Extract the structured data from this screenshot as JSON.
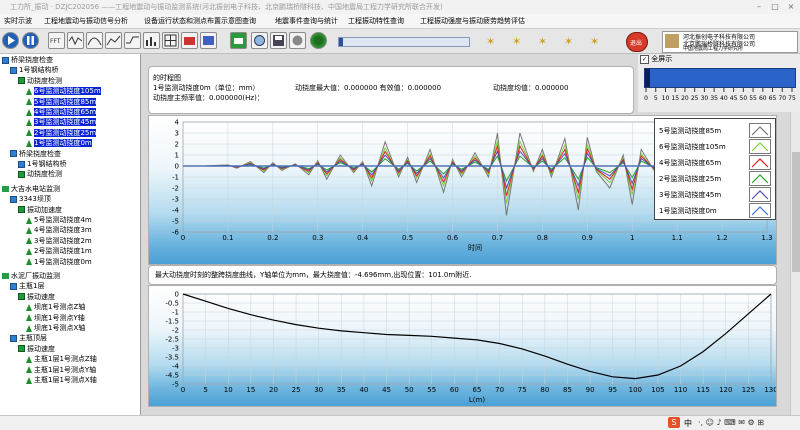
{
  "window_title": "工力所_振动 · DZJC202056 ——工程地震动与振动监测系统(河北振创电子科技、北京鹏瑞桥隧科技、中国地震局工程力学研究所联合开发)",
  "menu": [
    "实时示波",
    "工程地震动与振动信号分析",
    "设备运行状态和测点布置示意图查询",
    "地震事件查询与统计",
    "工程振动特性查询",
    "工程振动强度与振动疲劳趋势评估"
  ],
  "company_logo": {
    "line1": "河北振创电子科技有限公司",
    "line2": "北京鹏瑞桥隧科技有限公司",
    "line3": "中国地震局工程力学研究所"
  },
  "stop_label": "退出",
  "zoom_checkbox_label": "全屏示",
  "sidebar": {
    "items": [
      {
        "label": "桥梁挠度检查",
        "indent": 0,
        "icon": "net"
      },
      {
        "label": "1号钢结构桥",
        "indent": 1,
        "icon": "net"
      },
      {
        "label": "动挠度检测",
        "indent": 2,
        "icon": "sq"
      },
      {
        "label": "6号监测动挠度105m",
        "indent": 3,
        "icon": "tri",
        "selected": true
      },
      {
        "label": "5号监测动挠度85m",
        "indent": 3,
        "icon": "tri",
        "selected": true
      },
      {
        "label": "4号监测动挠度65m",
        "indent": 3,
        "icon": "tri",
        "selected": true
      },
      {
        "label": "3号监测动挠度45m",
        "indent": 3,
        "icon": "tri",
        "selected": true
      },
      {
        "label": "2号监测动挠度25m",
        "indent": 3,
        "icon": "tri",
        "selected": true
      },
      {
        "label": "1号监测动挠度0m",
        "indent": 3,
        "icon": "tri",
        "selected": true
      },
      {
        "label": "桥梁挠度检查",
        "indent": 1,
        "icon": "net"
      },
      {
        "label": "1号钢结构桥",
        "indent": 2,
        "icon": "net"
      },
      {
        "label": "动挠度检测",
        "indent": 2,
        "icon": "sq"
      },
      {
        "label": "",
        "indent": 0,
        "icon": "none"
      },
      {
        "label": "大吉水电站监测",
        "indent": 0,
        "icon": "flag"
      },
      {
        "label": "3343坝顶",
        "indent": 1,
        "icon": "net"
      },
      {
        "label": "振动加速度",
        "indent": 2,
        "icon": "sq"
      },
      {
        "label": "5号监测动挠度4m",
        "indent": 3,
        "icon": "tri"
      },
      {
        "label": "4号监测动挠度3m",
        "indent": 3,
        "icon": "tri"
      },
      {
        "label": "3号监测动挠度2m",
        "indent": 3,
        "icon": "tri"
      },
      {
        "label": "2号监测动挠度1m",
        "indent": 3,
        "icon": "tri"
      },
      {
        "label": "1号监测动挠度0m",
        "indent": 3,
        "icon": "tri"
      },
      {
        "label": "",
        "indent": 0,
        "icon": "none"
      },
      {
        "label": "水泥厂振动监测",
        "indent": 0,
        "icon": "flag"
      },
      {
        "label": "主瓶1层",
        "indent": 1,
        "icon": "net"
      },
      {
        "label": "振动速度",
        "indent": 2,
        "icon": "sq"
      },
      {
        "label": "坝底1号测点Z轴",
        "indent": 3,
        "icon": "tri"
      },
      {
        "label": "坝底1号测点Y轴",
        "indent": 3,
        "icon": "tri"
      },
      {
        "label": "坝底1号测点X轴",
        "indent": 3,
        "icon": "tri"
      },
      {
        "label": "主瓶顶层",
        "indent": 1,
        "icon": "net"
      },
      {
        "label": "振动速度",
        "indent": 2,
        "icon": "sq"
      },
      {
        "label": "主瓶1层1号测点Z轴",
        "indent": 3,
        "icon": "tri"
      },
      {
        "label": "主瓶1层1号测点Y轴",
        "indent": 3,
        "icon": "tri"
      },
      {
        "label": "主瓶1层1号测点X轴",
        "indent": 3,
        "icon": "tri"
      }
    ]
  },
  "info": {
    "heading": "的时程图",
    "line1a": "1号监测动挠度0m（单位：mm）",
    "line1b": "动挠度最大值：0.000000 有效值：0.000000",
    "line1c": "动挠度均值：0.000000",
    "line2": "动挠度主频率值：0.000000(Hz)："
  },
  "slider": {
    "ticks": [
      "0",
      "5",
      "10",
      "15",
      "20",
      "25",
      "30",
      "35",
      "40",
      "45",
      "50",
      "55",
      "60",
      "65",
      "70",
      "75"
    ],
    "value": 0
  },
  "colors": {
    "series_85m": "#777777",
    "series_105m": "#7fcf3a",
    "series_65m": "#e02020",
    "series_25m": "#2aa02a",
    "series_45m": "#5050b0",
    "series_0m": "#4070d0",
    "selection": "#0a24d6"
  },
  "chart_data": [
    {
      "type": "line",
      "xlabel": "时间",
      "ylabel": "",
      "xlim": [
        0,
        1.3
      ],
      "ylim": [
        -6,
        4
      ],
      "xticks": [
        "0",
        "0.1",
        "0.2",
        "0.3",
        "0.4",
        "0.5",
        "0.6",
        "0.7",
        "0.8",
        "0.9",
        "1",
        "1.1",
        "1.2",
        "1.3"
      ],
      "yticks": [
        "4",
        "3",
        "2",
        "1",
        "0",
        "-1",
        "-2",
        "-3",
        "-4",
        "-5",
        "-6"
      ],
      "x": [
        0,
        0.05,
        0.1,
        0.12,
        0.15,
        0.18,
        0.2,
        0.22,
        0.25,
        0.28,
        0.3,
        0.32,
        0.35,
        0.38,
        0.4,
        0.42,
        0.45,
        0.48,
        0.5,
        0.52,
        0.55,
        0.58,
        0.6,
        0.62,
        0.65,
        0.68,
        0.7,
        0.72,
        0.75,
        0.78,
        0.8,
        0.82,
        0.85,
        0.88,
        0.9,
        0.92,
        0.95,
        0.98,
        1.0,
        1.02,
        1.05,
        1.08,
        1.1,
        1.12,
        1.15,
        1.18,
        1.2,
        1.22,
        1.25,
        1.28,
        1.3
      ],
      "series": [
        {
          "name": "5号监测动挠度85m",
          "color_key": "series_85m",
          "values": [
            0,
            0,
            0.1,
            -0.2,
            0.4,
            -0.6,
            0.3,
            -0.4,
            0.2,
            -0.8,
            0.5,
            -1.2,
            1.0,
            -0.6,
            0.4,
            -1.8,
            2.2,
            -1.0,
            0.8,
            -1.5,
            1.5,
            -2.4,
            0.6,
            -1.0,
            1.2,
            -1.0,
            3.0,
            -4.5,
            3.0,
            -0.5,
            1.5,
            -1.0,
            2.5,
            -4.0,
            2.6,
            -0.5,
            -2.0,
            1.0,
            -3.5,
            1.5,
            -0.5,
            1.0,
            2.0,
            -1.0,
            3.5,
            -1.5,
            1.0,
            -0.5,
            2.6,
            0.5,
            2.5
          ]
        },
        {
          "name": "6号监测动挠度105m",
          "color_key": "series_105m",
          "values": [
            0,
            0,
            0.08,
            -0.15,
            0.3,
            -0.45,
            0.22,
            -0.3,
            0.15,
            -0.6,
            0.38,
            -0.9,
            0.75,
            -0.45,
            0.3,
            -1.35,
            1.65,
            -0.75,
            0.6,
            -1.1,
            1.1,
            -1.8,
            0.45,
            -0.75,
            0.9,
            -0.75,
            2.25,
            -3.4,
            2.25,
            -0.38,
            1.1,
            -0.75,
            1.9,
            -3.0,
            1.95,
            -0.38,
            -1.5,
            0.75,
            -2.6,
            1.1,
            -0.38,
            0.75,
            1.5,
            -0.75,
            2.6,
            -1.1,
            0.75,
            -0.38,
            1.95,
            0.38,
            1.9
          ]
        },
        {
          "name": "4号监测动挠度65m",
          "color_key": "series_65m",
          "values": [
            0,
            0,
            0.06,
            -0.12,
            0.24,
            -0.36,
            0.18,
            -0.24,
            0.12,
            -0.48,
            0.3,
            -0.72,
            0.6,
            -0.36,
            0.24,
            -1.08,
            1.32,
            -0.6,
            0.48,
            -0.9,
            0.9,
            -1.44,
            0.36,
            -0.6,
            0.72,
            -0.6,
            1.8,
            -2.7,
            1.8,
            -0.3,
            0.9,
            -0.6,
            1.5,
            -2.4,
            1.56,
            -0.3,
            -1.2,
            0.6,
            -2.1,
            0.9,
            -0.3,
            0.6,
            1.2,
            -0.6,
            2.1,
            -0.9,
            0.6,
            -0.3,
            1.56,
            0.3,
            1.5
          ]
        },
        {
          "name": "2号监测动挠度25m",
          "color_key": "series_25m",
          "values": [
            0,
            0,
            0.03,
            -0.06,
            0.12,
            -0.18,
            0.09,
            -0.12,
            0.06,
            -0.24,
            0.15,
            -0.36,
            0.3,
            -0.18,
            0.12,
            -0.54,
            0.66,
            -0.3,
            0.24,
            -0.45,
            0.45,
            -0.72,
            0.18,
            -0.3,
            0.36,
            -0.3,
            0.9,
            -1.35,
            0.9,
            -0.15,
            0.45,
            -0.3,
            0.75,
            -1.2,
            0.78,
            -0.15,
            -0.6,
            0.3,
            -1.05,
            0.45,
            -0.15,
            0.3,
            0.6,
            -0.3,
            1.05,
            -0.45,
            0.3,
            -0.15,
            0.78,
            0.15,
            0.75
          ]
        },
        {
          "name": "3号监测动挠度45m",
          "color_key": "series_45m",
          "values": [
            0,
            0,
            0.05,
            -0.09,
            0.18,
            -0.27,
            0.14,
            -0.18,
            0.09,
            -0.36,
            0.23,
            -0.54,
            0.45,
            -0.27,
            0.18,
            -0.81,
            0.99,
            -0.45,
            0.36,
            -0.68,
            0.68,
            -1.08,
            0.27,
            -0.45,
            0.54,
            -0.45,
            1.35,
            -2.0,
            1.35,
            -0.23,
            0.68,
            -0.45,
            1.13,
            -1.8,
            1.17,
            -0.23,
            -0.9,
            0.45,
            -1.58,
            0.68,
            -0.23,
            0.45,
            0.9,
            -0.45,
            1.58,
            -0.68,
            0.45,
            -0.23,
            1.17,
            0.23,
            1.13
          ]
        },
        {
          "name": "1号监测动挠度0m",
          "color_key": "series_0m",
          "values": [
            0,
            0,
            0,
            0,
            0,
            0,
            0,
            0,
            0,
            0,
            0,
            0,
            0,
            0,
            0,
            0,
            0,
            0,
            0,
            0,
            0,
            0,
            0,
            0,
            0,
            0,
            0,
            0,
            0,
            0,
            0,
            0,
            0,
            0,
            0,
            0,
            0,
            0,
            0,
            0,
            0,
            0,
            0,
            0,
            0,
            0,
            0,
            0,
            0,
            0,
            0
          ]
        }
      ],
      "legend_position": "top-right"
    },
    {
      "type": "line",
      "title": "最大动挠度时刻的整跨挠度曲线，Y轴单位为mm，最大挠度值：-4.696mm,出现位置：101.0m附近.",
      "xlabel": "L(m)",
      "ylabel": "",
      "xlim": [
        0,
        130
      ],
      "ylim": [
        -5,
        0
      ],
      "xticks": [
        "0",
        "5",
        "10",
        "15",
        "20",
        "25",
        "30",
        "35",
        "40",
        "45",
        "50",
        "55",
        "60",
        "65",
        "70",
        "75",
        "80",
        "85",
        "90",
        "95",
        "100",
        "105",
        "110",
        "115",
        "120",
        "125",
        "130"
      ],
      "yticks": [
        "0",
        "-0.5",
        "-1",
        "-1.5",
        "-2",
        "-2.5",
        "-3",
        "-3.5",
        "-4",
        "-4.5",
        "-5"
      ],
      "x": [
        0,
        5,
        10,
        15,
        20,
        25,
        30,
        35,
        40,
        45,
        50,
        55,
        60,
        65,
        70,
        75,
        80,
        85,
        90,
        95,
        100,
        105,
        110,
        115,
        120,
        125,
        130
      ],
      "values": [
        0,
        -0.4,
        -0.8,
        -1.15,
        -1.45,
        -1.7,
        -1.9,
        -2.05,
        -2.15,
        -2.25,
        -2.3,
        -2.35,
        -2.45,
        -2.55,
        -2.75,
        -3.05,
        -3.45,
        -3.9,
        -4.3,
        -4.6,
        -4.7,
        -4.5,
        -4.0,
        -3.2,
        -2.2,
        -1.1,
        0
      ]
    }
  ],
  "statusbar": {
    "ime": "中",
    "ime_icons": "·,  ☺  ♪  ⌨  ✉  ⚙  ⊞"
  }
}
